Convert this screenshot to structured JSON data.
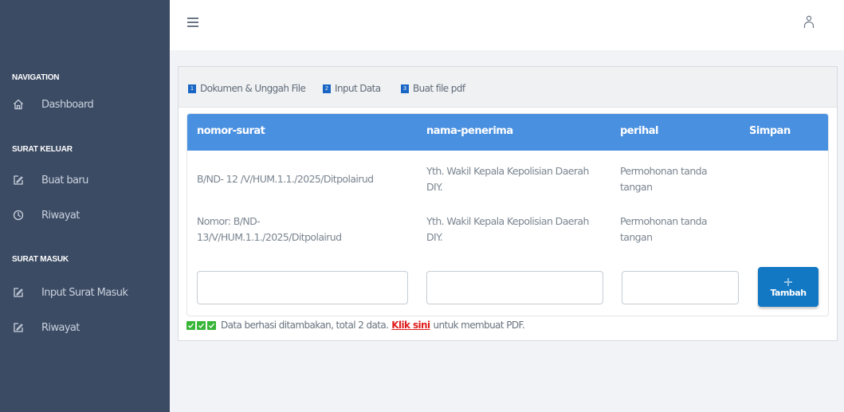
{
  "sidebar": {
    "sections": [
      {
        "title": "NAVIGATION"
      },
      {
        "title": "SURAT KELUAR"
      },
      {
        "title": "SURAT MASUK"
      }
    ],
    "items": [
      {
        "label": "Dashboard",
        "icon": "home-icon"
      },
      {
        "label": "Buat baru",
        "icon": "edit-icon"
      },
      {
        "label": "Riwayat",
        "icon": "clock-icon"
      },
      {
        "label": "Input Surat Masuk",
        "icon": "edit-icon"
      },
      {
        "label": "Riwayat",
        "icon": "edit-icon"
      }
    ]
  },
  "header": {
    "menu_icon": "hamburger-icon",
    "user_icon": "user-icon"
  },
  "steps": [
    {
      "num": "1",
      "label": "Dokumen & Unggah File"
    },
    {
      "num": "2",
      "label": "Input Data"
    },
    {
      "num": "3",
      "label": "Buat file pdf"
    }
  ],
  "table": {
    "columns": [
      "nomor-surat",
      "nama-penerima",
      "perihal",
      "Simpan"
    ],
    "rows": [
      {
        "nomor": "B/ND- 12 /V/HUM.1.1./2025/Ditpolairud",
        "penerima": "Yth. Wakil Kepala Kepolisian Daerah DIY.",
        "perihal": "Permohonan tanda tangan"
      },
      {
        "nomor": "Nomor: B/ND-13/V/HUM.1.1./2025/Ditpolairud",
        "penerima": "Yth. Wakil Kepala Kepolisian Daerah DIY.",
        "perihal": "Permohonan tanda tangan"
      }
    ],
    "inputs": {
      "nomor": "",
      "penerima": "",
      "perihal": ""
    },
    "add_button": "Tambah"
  },
  "status": {
    "message": "Data berhasi ditambakan, total 2 data.",
    "link": "Klik sini",
    "suffix": "untuk membuat PDF."
  },
  "colors": {
    "sidebar_bg": "#3c4b64",
    "table_header": "#4a90e0",
    "step_badge": "#1a66c4",
    "add_button": "#1278c4",
    "check": "#36b536",
    "link": "#e01e1e"
  }
}
